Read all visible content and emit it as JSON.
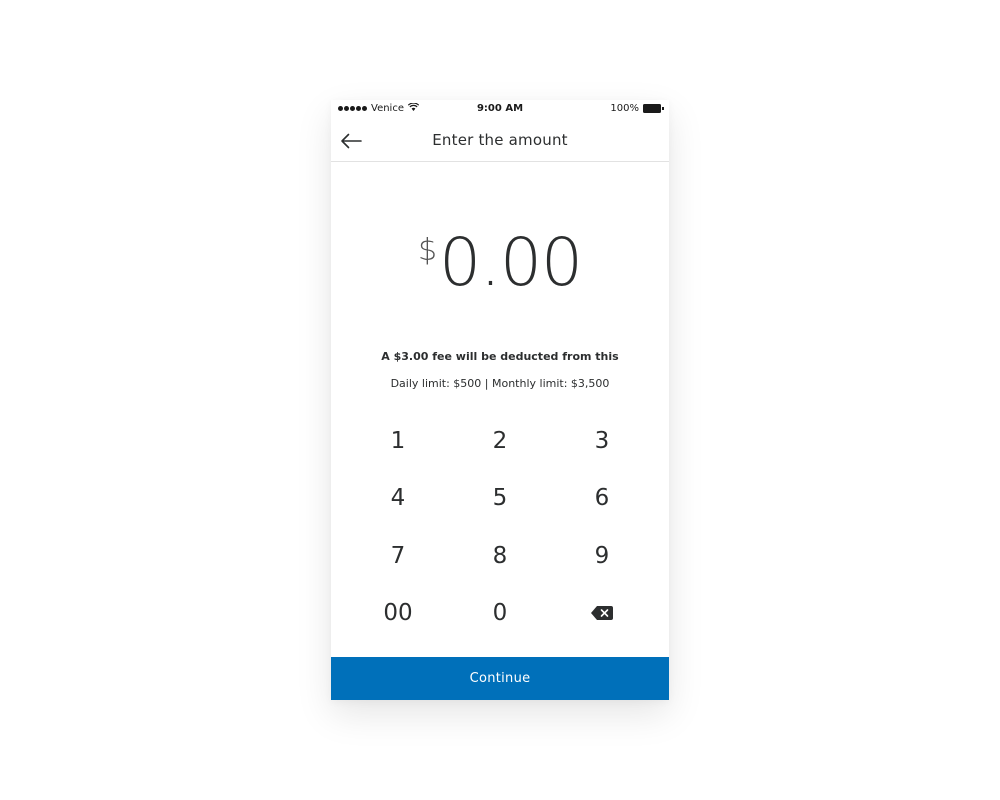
{
  "status_bar": {
    "carrier": "Venice",
    "time": "9:00 AM",
    "battery": "100%"
  },
  "nav": {
    "back_icon": "arrow-left-icon",
    "title": "Enter the amount"
  },
  "amount": {
    "currency": "$",
    "value": "0.00"
  },
  "info": {
    "fee": "A $3.00 fee will be deducted from this",
    "limits": "Daily limit: $500 | Monthly limit: $3,500"
  },
  "keypad": {
    "keys": [
      "1",
      "2",
      "3",
      "4",
      "5",
      "6",
      "7",
      "8",
      "9",
      "00",
      "0"
    ],
    "backspace_icon": "backspace-icon"
  },
  "continue_label": "Continue",
  "colors": {
    "primary": "#0070ba",
    "text": "#2c2e2f",
    "divider": "#e2e2e2"
  }
}
